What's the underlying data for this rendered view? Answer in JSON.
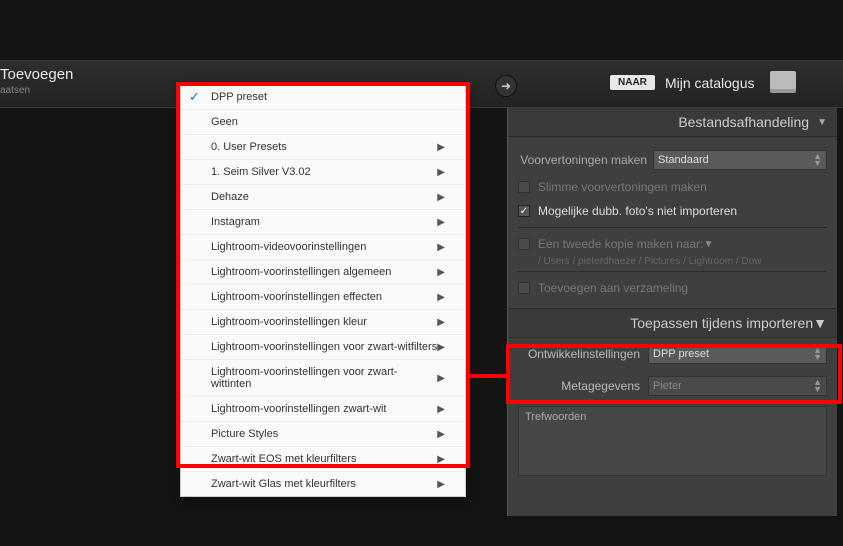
{
  "topbar": {
    "title": "Toevoegen",
    "subtitle": "aatsen",
    "naar_badge": "NAAR",
    "catalog_label": "Mijn catalogus"
  },
  "panel_file": {
    "header": "Bestandsafhandeling",
    "preview_label": "Voorvertoningen maken",
    "preview_value": "Standaard",
    "smart_preview": "Slimme voorvertoningen maken",
    "no_dup": "Mogelijke dubb. foto's niet importeren",
    "second_copy": "Een tweede kopie maken naar:",
    "second_copy_path": "/ Users / pieterdhaeze / Pictures / Lightroom / Dow",
    "add_collection": "Toevoegen aan verzameling"
  },
  "panel_apply": {
    "header": "Toepassen tijdens importeren",
    "dev_label": "Ontwikkelinstellingen",
    "dev_value": "DPP preset",
    "meta_label": "Metagegevens",
    "meta_value": "Pieter",
    "keywords_label": "Trefwoorden"
  },
  "dropdown": {
    "selected": "DPP preset",
    "none": "Geen",
    "submenus": [
      "0. User Presets",
      "1. Seim Silver V3.02",
      "Dehaze",
      "Instagram",
      "Lightroom-videovoorinstellingen",
      "Lightroom-voorinstellingen algemeen",
      "Lightroom-voorinstellingen effecten",
      "Lightroom-voorinstellingen kleur",
      "Lightroom-voorinstellingen voor zwart-witfilters",
      "Lightroom-voorinstellingen voor zwart-wittinten",
      "Lightroom-voorinstellingen zwart-wit",
      "Picture Styles",
      "Zwart-wit EOS met kleurfilters",
      "Zwart-wit Glas met kleurfilters"
    ]
  }
}
